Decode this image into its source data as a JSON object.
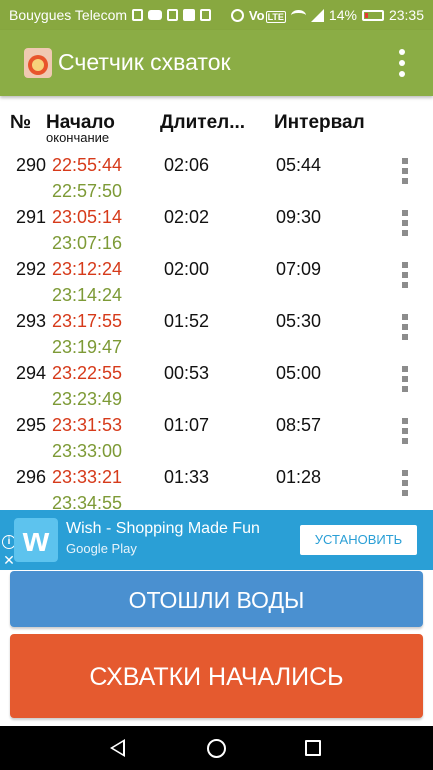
{
  "status_bar": {
    "carrier": "Bouygues Telecom",
    "battery_percent": "14%",
    "time": "23:35",
    "network_label": "Vo",
    "lte_label": "LTE"
  },
  "app_bar": {
    "title": "Счетчик схваток"
  },
  "table_header": {
    "num": "№",
    "start": "Начало",
    "end": "окончание",
    "duration": "Длител...",
    "interval": "Интервал"
  },
  "rows": [
    {
      "num": "290",
      "start": "22:55:44",
      "end": "22:57:50",
      "duration": "02:06",
      "interval": "05:44"
    },
    {
      "num": "291",
      "start": "23:05:14",
      "end": "23:07:16",
      "duration": "02:02",
      "interval": "09:30"
    },
    {
      "num": "292",
      "start": "23:12:24",
      "end": "23:14:24",
      "duration": "02:00",
      "interval": "07:09"
    },
    {
      "num": "293",
      "start": "23:17:55",
      "end": "23:19:47",
      "duration": "01:52",
      "interval": "05:30"
    },
    {
      "num": "294",
      "start": "23:22:55",
      "end": "23:23:49",
      "duration": "00:53",
      "interval": "05:00"
    },
    {
      "num": "295",
      "start": "23:31:53",
      "end": "23:33:00",
      "duration": "01:07",
      "interval": "08:57"
    },
    {
      "num": "296",
      "start": "23:33:21",
      "end": "23:34:55",
      "duration": "01:33",
      "interval": "01:28"
    }
  ],
  "ad": {
    "title": "Wish - Shopping Made Fun",
    "subtitle": "Google Play",
    "install_label": "УСТАНОВИТЬ",
    "logo_letter": "w"
  },
  "buttons": {
    "waters_broke": "ОТОШЛИ ВОДЫ",
    "contractions_started": "СХВАТКИ НАЧАЛИСЬ"
  },
  "colors": {
    "app_bar": "#8bad45",
    "start_time": "#d63a1a",
    "end_time": "#7d9a36",
    "waters_button": "#4a90d0",
    "contractions_button": "#e55a2f",
    "ad_banner": "#2a9fd6"
  }
}
